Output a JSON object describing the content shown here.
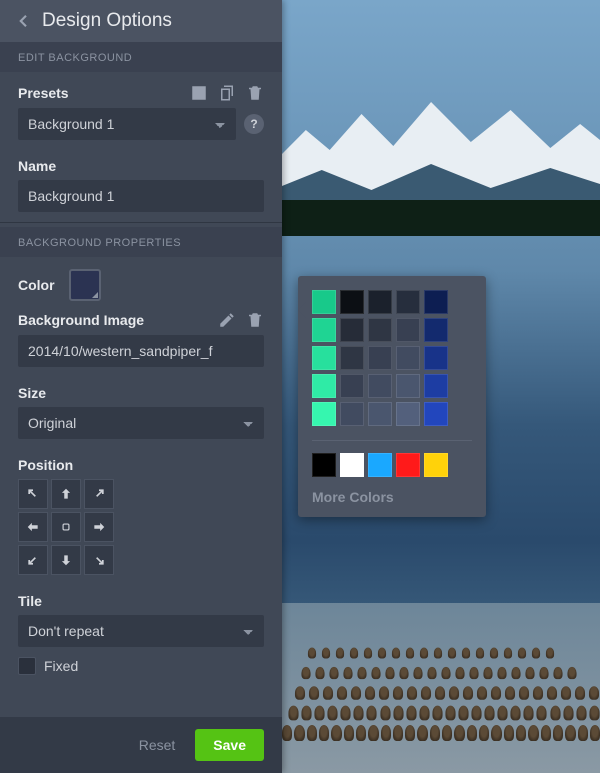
{
  "header": {
    "title": "Design Options"
  },
  "sections": {
    "edit_bg": "EDIT BACKGROUND",
    "bg_props": "BACKGROUND PROPERTIES"
  },
  "presets": {
    "label": "Presets",
    "selected": "Background 1"
  },
  "name": {
    "label": "Name",
    "value": "Background 1"
  },
  "color": {
    "label": "Color",
    "value": "#2b3352"
  },
  "bg_image": {
    "label": "Background Image",
    "value": "2014/10/western_sandpiper_f"
  },
  "size": {
    "label": "Size",
    "selected": "Original"
  },
  "position": {
    "label": "Position"
  },
  "tile": {
    "label": "Tile",
    "selected": "Don't repeat"
  },
  "fixed": {
    "label": "Fixed",
    "checked": false
  },
  "footer": {
    "reset": "Reset",
    "save": "Save"
  },
  "popover": {
    "grid": [
      "#18c98a",
      "#0c0f14",
      "#1b212c",
      "#262e3d",
      "#0d1e52",
      "#1fd493",
      "#262c38",
      "#2f3644",
      "#384052",
      "#132a6e",
      "#27e09d",
      "#2f3644",
      "#384052",
      "#414b60",
      "#183389",
      "#2feba6",
      "#384052",
      "#414b60",
      "#4a566e",
      "#1d3da3",
      "#36f6af",
      "#414b60",
      "#4a566e",
      "#53607c",
      "#2246bd"
    ],
    "recent": [
      "#000000",
      "#ffffff",
      "#1aa8ff",
      "#ff1a1a",
      "#ffd20a"
    ],
    "more": "More Colors"
  }
}
